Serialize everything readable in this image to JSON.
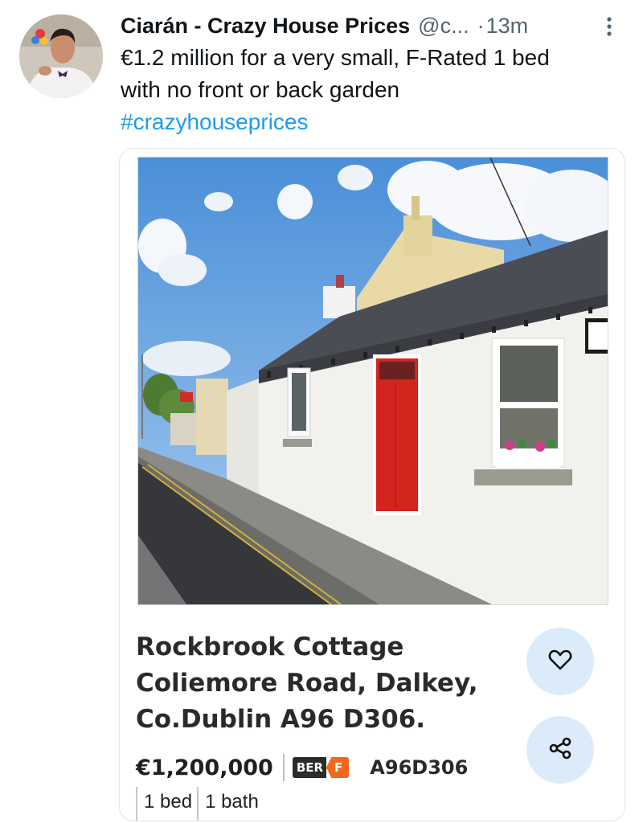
{
  "tweet": {
    "author_name": "Ciarán - Crazy House Prices",
    "handle": "@c...",
    "separator": "·",
    "time_ago": "13m",
    "text_lines": [
      "€1.2 million for a very small, F-Rated 1 bed",
      "with no front or back garden"
    ],
    "hashtag": "#crazyhouseprices",
    "icons": {
      "avatar": "avatar-photo",
      "more": "more-vertical-icon"
    }
  },
  "listing": {
    "title_lines": [
      "Rockbrook Cottage",
      "Coliemore Road, Dalkey,",
      "Co.Dublin A96 D306."
    ],
    "price": "€1,200,000",
    "ber_label": "BER",
    "ber_rating": "F",
    "eircode": "A96D306",
    "beds": "1 bed",
    "baths": "1 bath",
    "icons": {
      "favourite": "heart-icon",
      "share": "share-icon"
    },
    "colors": {
      "ber_rating": "#f06a1e",
      "action_button_bg": "#dcebfa",
      "door": "#d3241e"
    }
  },
  "colors": {
    "link": "#1d9bf0",
    "secondary_text": "#536471"
  }
}
